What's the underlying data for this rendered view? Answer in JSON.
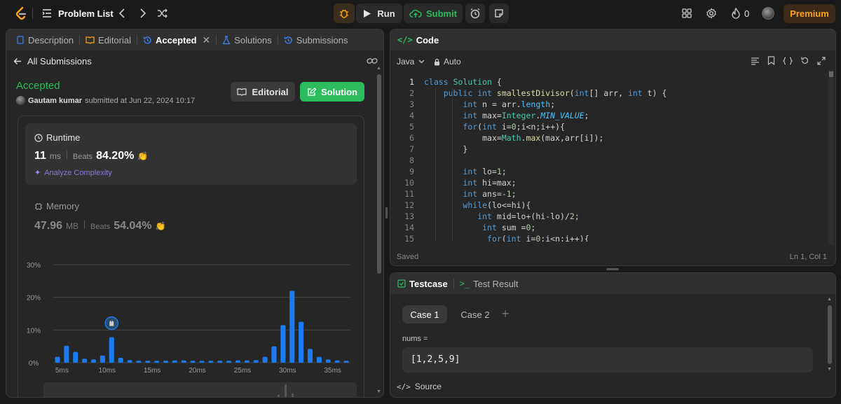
{
  "topbar": {
    "problem_list": "Problem List",
    "run": "Run",
    "submit": "Submit",
    "streak": "0",
    "premium": "Premium"
  },
  "left": {
    "tabs": [
      {
        "label": "Description"
      },
      {
        "label": "Editorial"
      },
      {
        "label": "Accepted"
      },
      {
        "label": "Solutions"
      },
      {
        "label": "Submissions"
      }
    ],
    "back_label": "All Submissions",
    "status": "Accepted",
    "user": "Gautam kumar",
    "submitted_text": "submitted at Jun 22, 2024 10:17",
    "editorial_btn": "Editorial",
    "solution_btn": "Solution",
    "runtime": {
      "title": "Runtime",
      "value": "11",
      "unit": "ms",
      "beats_label": "Beats",
      "beats": "84.20%",
      "analyze": "Analyze Complexity"
    },
    "memory": {
      "title": "Memory",
      "value": "47.96",
      "unit": "MB",
      "beats_label": "Beats",
      "beats": "54.04%"
    }
  },
  "chart_data": {
    "type": "bar",
    "ylim": [
      0,
      30
    ],
    "yticks": [
      "30%",
      "20%",
      "10%",
      "0%"
    ],
    "xticks": [
      "5ms",
      "10ms",
      "15ms",
      "20ms",
      "25ms",
      "30ms",
      "35ms"
    ],
    "values": [
      1.8,
      5.2,
      3.3,
      1.2,
      1.0,
      2.2,
      7.8,
      1.5,
      0.8,
      0.6,
      0.6,
      0.6,
      0.6,
      0.7,
      0.7,
      0.6,
      0.6,
      0.6,
      0.6,
      0.6,
      0.7,
      0.7,
      0.8,
      1.8,
      5.0,
      11.5,
      22.0,
      12.5,
      4.2,
      1.8,
      1.0,
      0.7,
      0.6
    ],
    "highlight_index": 6,
    "color": "#1a7cf0"
  },
  "code": {
    "title": "Code",
    "language": "Java",
    "mode": "Auto",
    "line_numbers": [
      "1",
      "2",
      "3",
      "4",
      "5",
      "6",
      "7",
      "8",
      "9",
      "10",
      "11",
      "12",
      "13",
      "14",
      "15"
    ],
    "lines": [
      "class Solution {",
      "    public int smallestDivisor(int[] arr, int t) {",
      "        int n = arr.length;",
      "        int max=Integer.MIN_VALUE;",
      "        for(int i=0;i<n;i++){",
      "            max=Math.max(max,arr[i]);",
      "        }",
      "",
      "        int lo=1;",
      "        int hi=max;",
      "        int ans=-1;",
      "        while(lo<=hi){",
      "           int mid=lo+(hi-lo)/2;",
      "            int sum =0;",
      "             for(int i=0;i<n;i++){"
    ],
    "status": "Saved",
    "cursor": "Ln 1, Col 1"
  },
  "testcase": {
    "tab1": "Testcase",
    "tab2": "Test Result",
    "cases": [
      "Case 1",
      "Case 2"
    ],
    "param": "nums =",
    "value": "[1,2,5,9]",
    "source": "Source"
  }
}
